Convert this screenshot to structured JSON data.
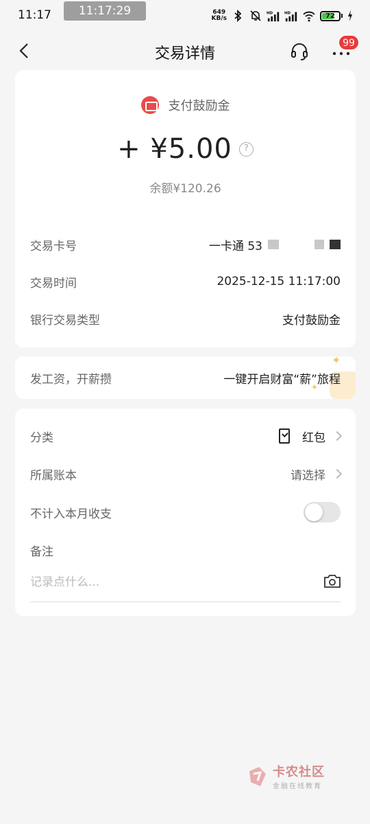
{
  "status_bar": {
    "time": "11:17",
    "overlay_time": "11:17:29",
    "net_speed_value": "649",
    "net_speed_unit": "KB/s",
    "battery": "72"
  },
  "header": {
    "title": "交易详情",
    "notification_count": "99"
  },
  "transaction": {
    "source_label": "支付鼓励金",
    "amount": "+ ¥5.00",
    "balance": "余额¥120.26",
    "details": [
      {
        "label": "交易卡号",
        "value": "一卡通 53"
      },
      {
        "label": "交易时间",
        "value": "2025-12-15 11:17:00"
      },
      {
        "label": "银行交易类型",
        "value": "支付鼓励金"
      }
    ]
  },
  "promo": {
    "left": "发工资，开薪攒",
    "right": "一键开启财富“薪”旅程"
  },
  "category": {
    "category_label": "分类",
    "category_value": "红包",
    "book_label": "所属账本",
    "book_value": "请选择",
    "exclude_label": "不计入本月收支",
    "exclude_on": false,
    "note_label": "备注",
    "note_placeholder": "记录点什么..."
  },
  "watermark": {
    "main": "卡农社区",
    "sub": "金融在线教育"
  },
  "colors": {
    "accent_red": "#ea4b4b",
    "badge_red": "#e93a3a",
    "battery_green": "#4cc34c"
  }
}
